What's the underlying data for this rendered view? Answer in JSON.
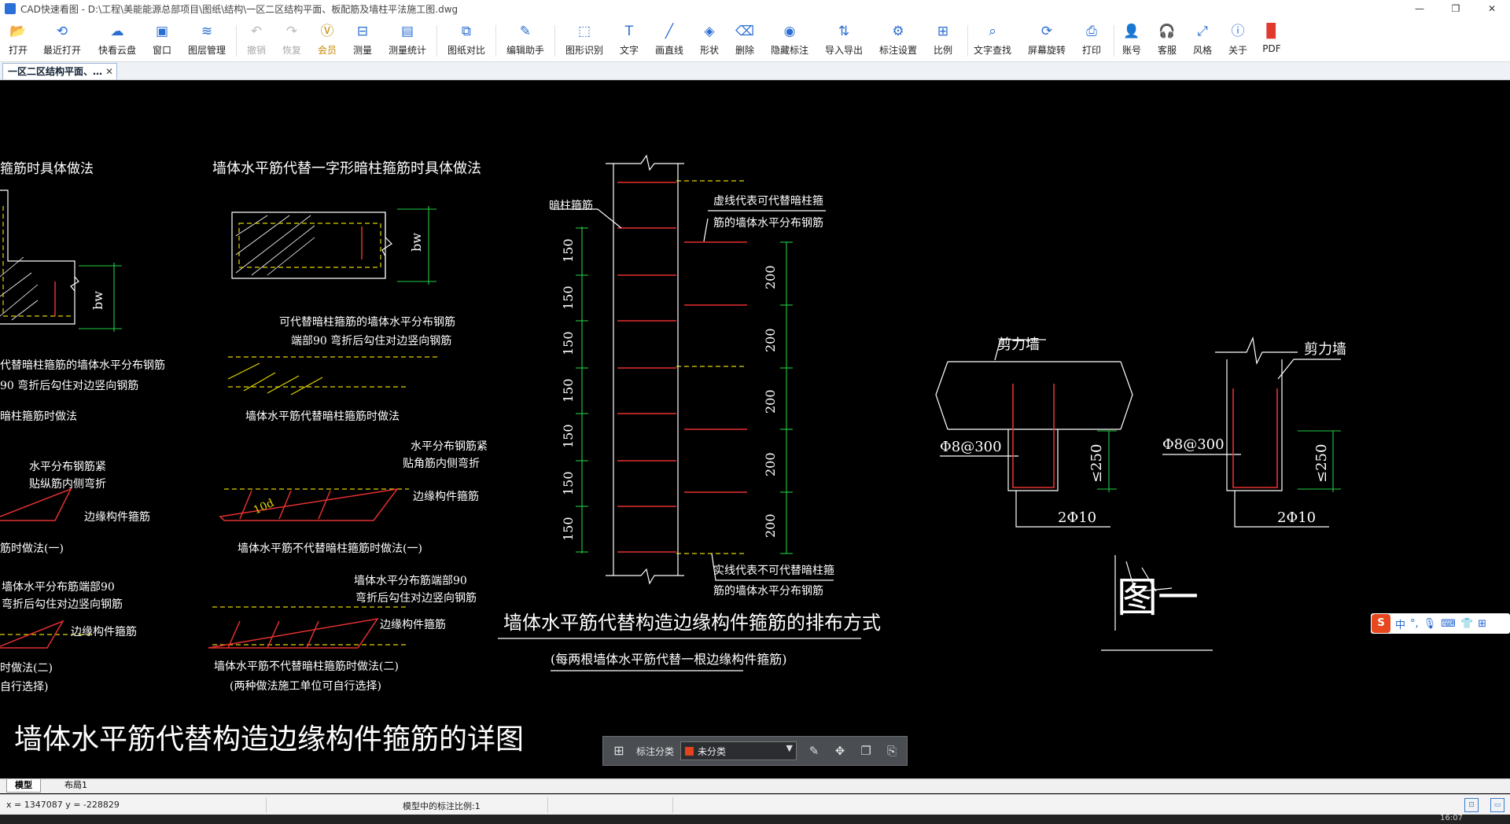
{
  "window": {
    "title": "CAD快速看图 - D:\\工程\\美能能源总部项目\\图纸\\结构\\一区二区结构平面、板配筋及墙柱平法施工图.dwg",
    "controls": [
      "—",
      "❐",
      "✕"
    ]
  },
  "toolbar": {
    "items": [
      {
        "label": "打开",
        "icon": "folder-open-icon"
      },
      {
        "label": "最近打开",
        "icon": "history-icon"
      },
      {
        "label": "快看云盘",
        "icon": "cloud-icon"
      },
      {
        "label": "窗口",
        "icon": "window-icon"
      },
      {
        "label": "图层管理",
        "icon": "layers-icon"
      },
      {
        "label": "撤销",
        "icon": "undo-icon"
      },
      {
        "label": "恢复",
        "icon": "redo-icon"
      },
      {
        "label": "会员",
        "icon": "vip-icon"
      },
      {
        "label": "测量",
        "icon": "ruler-icon"
      },
      {
        "label": "测量统计",
        "icon": "measure-stats-icon"
      },
      {
        "label": "图纸对比",
        "icon": "compare-icon"
      },
      {
        "label": "编辑助手",
        "icon": "edit-assistant-icon"
      },
      {
        "label": "图形识别",
        "icon": "shape-recognize-icon"
      },
      {
        "label": "文字",
        "icon": "text-icon"
      },
      {
        "label": "画直线",
        "icon": "line-icon"
      },
      {
        "label": "形状",
        "icon": "shape-icon"
      },
      {
        "label": "删除",
        "icon": "eraser-icon"
      },
      {
        "label": "隐藏标注",
        "icon": "eye-hide-icon"
      },
      {
        "label": "导入导出",
        "icon": "import-export-icon"
      },
      {
        "label": "标注设置",
        "icon": "annotation-settings-icon"
      },
      {
        "label": "比例",
        "icon": "scale-icon"
      },
      {
        "label": "文字查找",
        "icon": "text-search-icon"
      },
      {
        "label": "屏幕旋转",
        "icon": "rotate-screen-icon"
      },
      {
        "label": "打印",
        "icon": "printer-icon"
      },
      {
        "label": "账号",
        "icon": "user-icon"
      },
      {
        "label": "客服",
        "icon": "headset-icon"
      },
      {
        "label": "风格",
        "icon": "style-icon"
      },
      {
        "label": "关于",
        "icon": "info-icon"
      },
      {
        "label": "PDF",
        "icon": "pdf-icon"
      }
    ]
  },
  "tabs": {
    "document": "一区二区结构平面、…",
    "close": "✕"
  },
  "drawing": {
    "t_a1": "箍筋时具体做法",
    "t_b1": "墙体水平筋代替一字形暗柱箍筋时具体做法",
    "bw": "bw",
    "t_a2": "代替暗柱箍筋的墙体水平分布钢筋",
    "t_a3": "90 弯折后勾住对边竖向钢筋",
    "t_b2": "可代替暗柱箍筋的墙体水平分布钢筋",
    "t_b3": "端部90 弯折后勾住对边竖向钢筋",
    "t_a4": "暗柱箍筋时做法",
    "t_b4": "墙体水平筋代替暗柱箍筋时做法",
    "t_a5": "水平分布钢筋紧",
    "t_a6": "贴纵筋内侧弯折",
    "t_a7": "边缘构件箍筋",
    "t_a8": "筋时做法(一)",
    "t_b5": "水平分布钢筋紧",
    "t_b6": "贴角筋内侧弯折",
    "t_b7": "边缘构件箍筋",
    "t_b8": "墙体水平筋不代替暗柱箍筋时做法(一)",
    "ten_d": "10d",
    "t_a9": "墙体水平分布筋端部90",
    "t_a10": "弯折后勾住对边竖向钢筋",
    "t_a11": "边缘构件箍筋",
    "t_a12": "时做法(二)",
    "t_a13": "自行选择)",
    "t_b9": "墙体水平分布筋端部90",
    "t_b10": "弯折后勾住对边竖向钢筋",
    "t_b11": "边缘构件箍筋",
    "t_b12": "墙体水平筋不代替暗柱箍筋时做法(二)",
    "t_b13": "(两种做法施工单位可自行选择)",
    "big_title": "墙体水平筋代替构造边缘构件箍筋的详图",
    "c_label": "暗柱箍筋",
    "c_note1": "虚线代表可代替暗柱箍",
    "c_note2": "筋的墙体水平分布钢筋",
    "c_dims_left": [
      "150",
      "150",
      "150",
      "150",
      "150",
      "150",
      "150"
    ],
    "c_dims_right": [
      "200",
      "200",
      "200",
      "200",
      "200"
    ],
    "c_note3": "实线代表不可代替暗柱箍",
    "c_note4": "筋的墙体水平分布钢筋",
    "c_title": "墙体水平筋代替构造边缘构件箍筋的排布方式",
    "c_sub": "(每两根墙体水平筋代替一根边缘构件箍筋)",
    "d_label1": "剪力墙",
    "d_rebar1": "Φ8@300",
    "d_dim1": "≤250",
    "d_bars1": "2Φ10",
    "d_label2": "剪力墙",
    "d_rebar2": "Φ8@300",
    "d_dim2": "≤250",
    "d_bars2": "2Φ10",
    "fig": "图一"
  },
  "annotation_toolbar": {
    "label": "标注分类",
    "category": "未分类",
    "swatch_color": "#e2431b"
  },
  "layout_tabs": [
    "模型",
    "布局1"
  ],
  "status": {
    "coords": "x = 1347087  y = -228829",
    "scale": "模型中的标注比例:1"
  },
  "ime": {
    "label1": "中",
    "label2": "°,"
  },
  "clock": "16:07"
}
